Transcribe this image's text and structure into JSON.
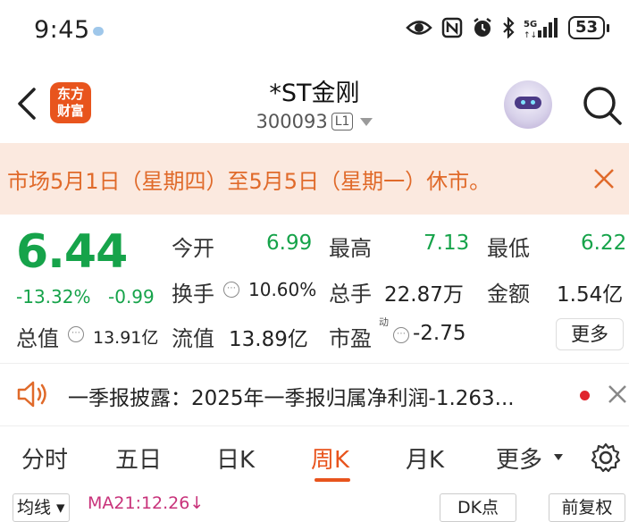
{
  "status_bar": {
    "time": "9:45",
    "battery": "53",
    "icons": [
      "eye-icon",
      "nfc-icon",
      "alarm-icon",
      "bluetooth-icon",
      "signal-5g-icon"
    ]
  },
  "header": {
    "logo_line1": "东方",
    "logo_line2": "财富",
    "title": "*ST金刚",
    "code": "300093",
    "level": "L1"
  },
  "notice": {
    "text": "市场5月1日（星期四）至5月5日（星期一）休市。"
  },
  "quote": {
    "price": "6.44",
    "change_pct": "-13.32%",
    "change_abs": "-0.99",
    "open_label": "今开",
    "open": "6.99",
    "high_label": "最高",
    "high": "7.13",
    "low_label": "最低",
    "low": "6.22",
    "turnover_label": "换手",
    "turnover": "10.60%",
    "volume_label": "总手",
    "volume": "22.87万",
    "amount_label": "金额",
    "amount": "1.54亿",
    "mktcap_label": "总值",
    "mktcap": "13.91亿",
    "float_label": "流值",
    "float_cap": "13.89亿",
    "pe_label": "市盈",
    "pe_sup": "动",
    "pe": "-2.75",
    "more": "更多"
  },
  "news": {
    "text": "一季报披露：2025年一季报归属净利润-1.263..."
  },
  "tabs": [
    {
      "label": "分时"
    },
    {
      "label": "五日"
    },
    {
      "label": "日K"
    },
    {
      "label": "周K"
    },
    {
      "label": "月K"
    },
    {
      "label": "更多"
    }
  ],
  "active_tab": "周K",
  "chart_toolbar": {
    "ma_select": "均线",
    "ma_text": "MA21:12.26↓",
    "dk_label": "DK点",
    "adj_label": "前复权"
  },
  "colors": {
    "up_down_green": "#16a34a",
    "accent": "#e8541d",
    "notice_bg": "#fbe9df",
    "ma_line": "#c8327a"
  }
}
